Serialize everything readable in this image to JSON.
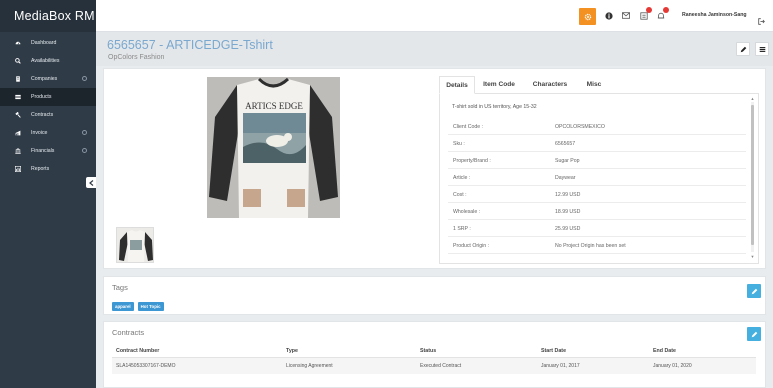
{
  "app": {
    "brand": "MediaBox RM"
  },
  "sidebar": {
    "items": [
      {
        "label": "Dashboard",
        "icon": "dashboard-icon"
      },
      {
        "label": "Availabilities",
        "icon": "search-icon"
      },
      {
        "label": "Companies",
        "icon": "building-icon"
      },
      {
        "label": "Products",
        "icon": "list-icon"
      },
      {
        "label": "Contracts",
        "icon": "gavel-icon"
      },
      {
        "label": "Invoice",
        "icon": "invoice-icon"
      },
      {
        "label": "Financials",
        "icon": "bank-icon"
      },
      {
        "label": "Reports",
        "icon": "chart-icon"
      }
    ]
  },
  "topbar": {
    "user_name": "Raneesha Jaminson-Sang",
    "accent_color": "#f39223"
  },
  "header": {
    "title": "6565657 - ARTICEDGE-Tshirt",
    "subtitle": "OpColors Fashion"
  },
  "product": {
    "image_text": "ARTICS EDGE",
    "tabs": [
      "Details",
      "Item Code",
      "Characters",
      "Misc"
    ],
    "description": "T-shirt sold in US territory, Age 15-32",
    "details": [
      {
        "label": "Client Code :",
        "value": "OPCOLORSMEXICO"
      },
      {
        "label": "Sku :",
        "value": "6565657"
      },
      {
        "label": "Property/Brand :",
        "value": "Sugar Pop"
      },
      {
        "label": "Article :",
        "value": "Daywear"
      },
      {
        "label": "Cost :",
        "value": "12.99 USD"
      },
      {
        "label": "Wholesale :",
        "value": "18.99 USD"
      },
      {
        "label": "1 SRP :",
        "value": "25.99 USD"
      },
      {
        "label": "Product Origin :",
        "value": "No Project Origin has been set"
      }
    ]
  },
  "tags": {
    "title": "Tags",
    "items": [
      "apparel",
      "Hot Topic"
    ]
  },
  "contracts": {
    "title": "Contracts",
    "columns": [
      "Contract Number",
      "Type",
      "Status",
      "Start Date",
      "End Date"
    ],
    "rows": [
      [
        "SLA145053307167-DEMO",
        "Licensing Agreement",
        "Executed Contract",
        "January 01, 2017",
        "January 01, 2020"
      ]
    ]
  }
}
